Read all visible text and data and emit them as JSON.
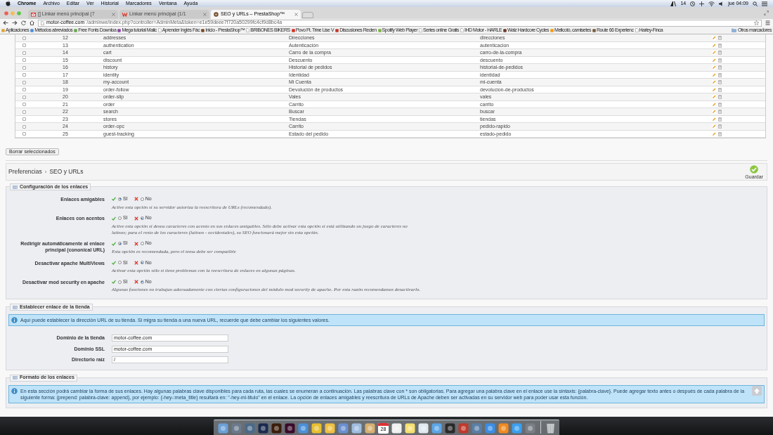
{
  "menubar": {
    "app": "Chrome",
    "menus": [
      "Archivo",
      "Editar",
      "Ver",
      "Historial",
      "Marcadores",
      "Ventana",
      "Ayuda"
    ],
    "badge_count": "14",
    "clock": "jue 04:09"
  },
  "tabs": [
    {
      "title": "[] Linkar menú principal (7",
      "selected": false
    },
    {
      "title": "Linkar menú principal (1/1",
      "selected": false
    },
    {
      "title": "SEO y URLs – PrestaShop™",
      "selected": true
    }
  ],
  "address_bar": {
    "host": "motor-coffee.com",
    "path": "/adminwe/index.php?controller=AdminMeta&token=e1e59deee7f720a50299fc4cf9d8bc4a"
  },
  "bookmarks": [
    "Aplicaciones",
    "Métodos abreviados",
    "Free Fonts Downloa",
    "Mega tutorial Mailc",
    "Aprender Inglés Fác",
    "Inicio - PrestaShop™",
    "BRIBONES BIKERS",
    "Povo Ft. Trine Lise V",
    "Discusiones Recien",
    "Spotify Web Player",
    "Series online Gratis",
    "IHD Motor - HARLE",
    "Walz Hardcore Cycles",
    "Melicotó, camisetes",
    "Route 66 Experienc",
    "Harley-Finca"
  ],
  "other_bookmarks": "Otros marcadores",
  "table": {
    "rows": [
      {
        "id": "12",
        "page": "addresses",
        "title": "Direcciones",
        "url": "direcciones",
        "checked": false
      },
      {
        "id": "13",
        "page": "authentication",
        "title": "Autenticación",
        "url": "autenticacion",
        "checked": false
      },
      {
        "id": "14",
        "page": "cart",
        "title": "Carro de la compra",
        "url": "carro-de-la-compra",
        "checked": false
      },
      {
        "id": "15",
        "page": "discount",
        "title": "Descuento",
        "url": "descuento",
        "checked": false
      },
      {
        "id": "16",
        "page": "history",
        "title": "Historial de pedidos",
        "url": "historial-de-pedidos",
        "checked": false
      },
      {
        "id": "17",
        "page": "identity",
        "title": "Identidad",
        "url": "identidad",
        "checked": false
      },
      {
        "id": "18",
        "page": "my-account",
        "title": "Mi Cuenta",
        "url": "mi-cuenta",
        "checked": false
      },
      {
        "id": "19",
        "page": "order-follow",
        "title": "Devolución de productos",
        "url": "devolucion-de-productos",
        "checked": false
      },
      {
        "id": "20",
        "page": "order-slip",
        "title": "Vales",
        "url": "vales",
        "checked": false
      },
      {
        "id": "21",
        "page": "order",
        "title": "Carrito",
        "url": "carrito",
        "checked": false
      },
      {
        "id": "22",
        "page": "search",
        "title": "Buscar",
        "url": "buscar",
        "checked": false
      },
      {
        "id": "23",
        "page": "stores",
        "title": "Tiendas",
        "url": "tiendas",
        "checked": false
      },
      {
        "id": "24",
        "page": "order-opc",
        "title": "Carrito",
        "url": "pedido-rapido",
        "checked": false
      },
      {
        "id": "25",
        "page": "guest-tracking",
        "title": "Estado del pedido",
        "url": "estado-pedido",
        "checked": false
      }
    ],
    "bulk_button": "Borrar seleccionados"
  },
  "breadcrumb": {
    "parent": "Preferencias",
    "separator": "›",
    "current": "SEO y URLs"
  },
  "save_button": "Guardar",
  "links_config": {
    "legend": "Configuración de los enlaces",
    "settings": [
      {
        "label": "Enlaces amigables",
        "options": [
          {
            "label": "SI",
            "selected": true
          },
          {
            "label": "No",
            "selected": false
          }
        ],
        "help": "Active esta opción si su servidor autoriza la reescritura de URLs (recomendado)."
      },
      {
        "label": "Enlaces con acentos",
        "options": [
          {
            "label": "SI",
            "selected": false
          },
          {
            "label": "No",
            "selected": true
          }
        ],
        "help": "Active esta opción si desea caracteres con acento en sus enlaces amigables. Sólo debe activar esta opción si está utilizando un juego de caracteres no latinos; para el resto de los caracteres (latinos - occidentales), su SEO funcionará mejor sin esta opción."
      },
      {
        "label": "Redirigir automáticamente al enlace principal (cononical URL)",
        "options": [
          {
            "label": "SI",
            "selected": true
          },
          {
            "label": "No",
            "selected": false
          }
        ],
        "help": "Esta opción es recomendada, pero el tema debe ser compatible"
      },
      {
        "label": "Desactivar apache MultiViews",
        "options": [
          {
            "label": "SI",
            "selected": false
          },
          {
            "label": "No",
            "selected": true
          }
        ],
        "help": "Activar esta opción sólo si tiene problemas con la reescritura de enlaces en algunas páginas."
      },
      {
        "label": "Desactivar mod security en apache",
        "options": [
          {
            "label": "SI",
            "selected": false
          },
          {
            "label": "No",
            "selected": true
          }
        ],
        "help": "Algunas funciones no trabajan adecuadamente con ciertas configuraciones del módulo mod security de apache. Por esta razón recomendamos desactivarlo."
      }
    ]
  },
  "shop_url": {
    "legend": "Establecer enlace de la tienda",
    "info": "Aquí puede establecer la dirección URL de su tienda. Si migra su tienda a una nueva URL, recuerde que debe cambiar los siguientes valores.",
    "fields": [
      {
        "label": "Dominio de la tienda",
        "value": "motor-coffee.com"
      },
      {
        "label": "Dominio SSL",
        "value": "motor-coffee.com"
      },
      {
        "label": "Directorio raíz",
        "value": "/"
      }
    ]
  },
  "link_format": {
    "legend": "Formato de los enlaces",
    "info": "En esta sección podrá cambiar la forma de sus enlaces. Hay algunas palabras clave disponibles para cada ruta, las cuales se enumeran a continuación. Las palabras clave con * son obligatorias. Para agregar una palabra clave en el enlace use la sintaxis: {palabra-clave}. Puede agregar texto antes o después de cada palabra de la siguiente forma: {prepend: palabra-clave: append}, por ejemplo: {-hey-:meta_title} resultará en: \"-hey-mi-titulo\" en el enlace. La opción de enlaces amigables y reescritura de URLs de Apache deben ser activadas en su servidor web para poder usar esta función."
  },
  "dock": {
    "calendar_day": "28"
  }
}
